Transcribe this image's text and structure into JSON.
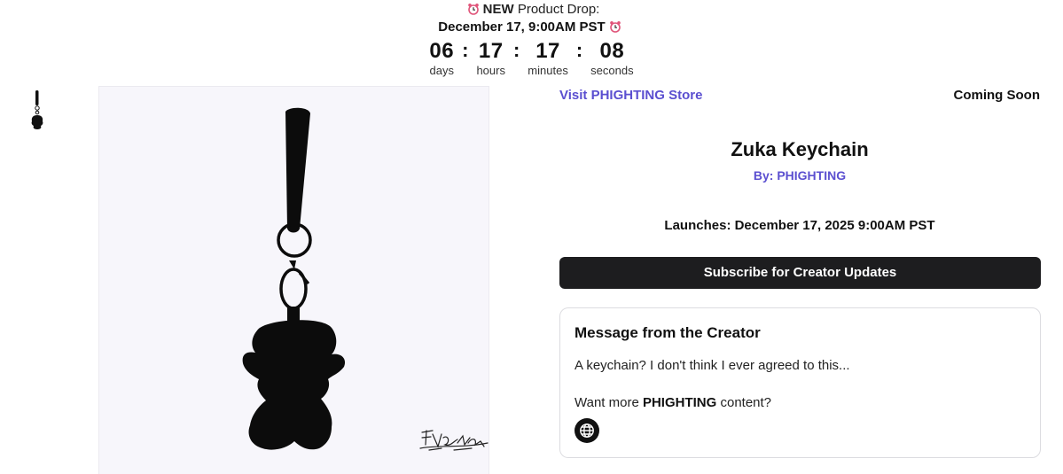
{
  "banner": {
    "new_label": "NEW",
    "drop_label": "Product Drop:",
    "date_label": "December 17, 9:00AM PST",
    "icon": "alarm-clock-icon"
  },
  "countdown": {
    "days": "06",
    "hours": "17",
    "minutes": "17",
    "seconds": "08",
    "days_label": "days",
    "hours_label": "hours",
    "minutes_label": "minutes",
    "seconds_label": "seconds",
    "separator": ":"
  },
  "product": {
    "store_link": "Visit PHIGHTING Store",
    "status": "Coming Soon",
    "title": "Zuka Keychain",
    "byline": "By: PHIGHTING",
    "launch": "Launches: December 17, 2025 9:00AM PST",
    "subscribe_label": "Subscribe for Creator Updates"
  },
  "message": {
    "title": "Message from the Creator",
    "body": "A keychain? I don't think I ever agreed to this...",
    "more_prefix": "Want more ",
    "more_brand": "PHIGHTING",
    "more_suffix": " content?",
    "link_icon": "globe-icon"
  },
  "colors": {
    "accent": "#5b4fd0",
    "button_bg": "#1d1d1f",
    "alarm": "#e0557a",
    "image_bg": "#f7f6fb"
  }
}
